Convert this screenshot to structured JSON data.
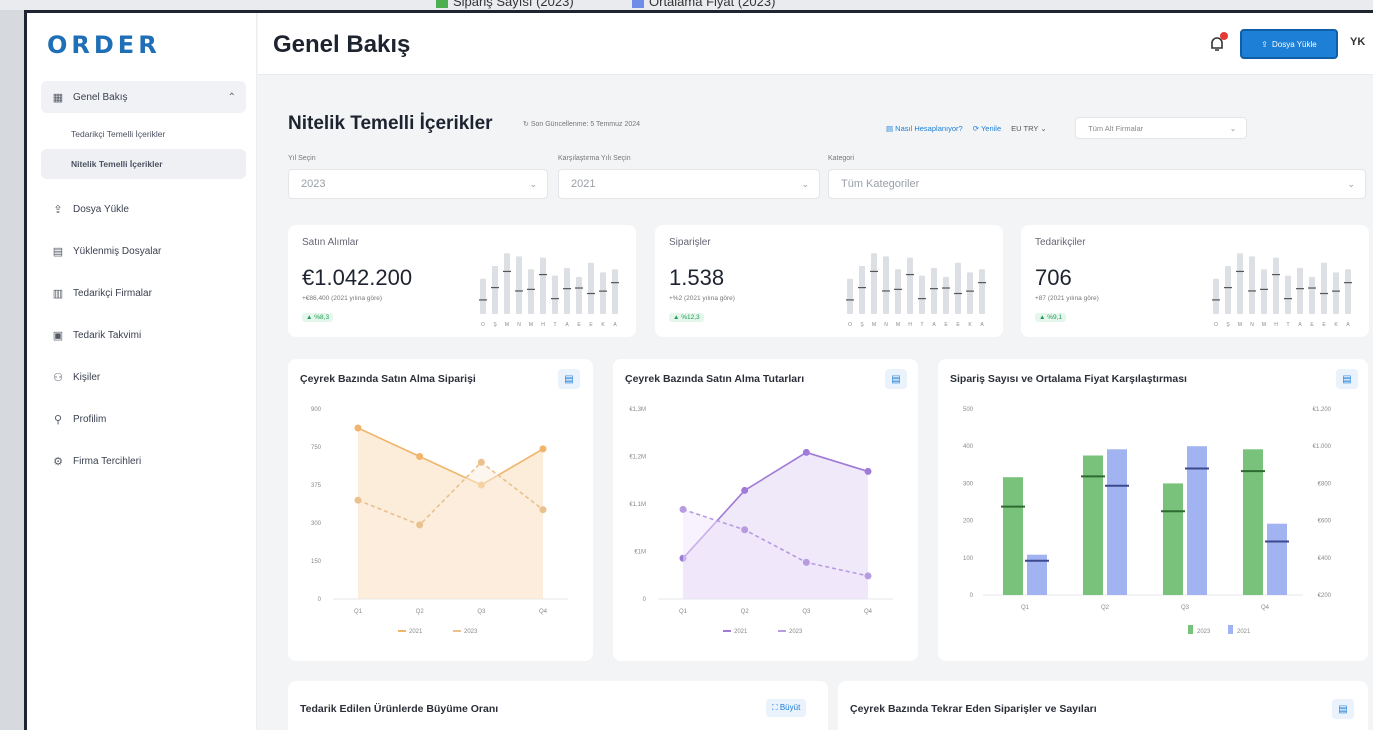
{
  "top_legend": [
    "Sipariş Sayısı (2023)",
    "Ortalama Fiyat (2023)"
  ],
  "brand": {
    "logo_text": "ORDER",
    "accent": "#1e7fd6"
  },
  "sidebar": {
    "items": [
      {
        "label": "Genel Bakış",
        "icon": "grid-icon"
      },
      {
        "label": "Dosya Yükle",
        "icon": "upload-icon"
      },
      {
        "label": "Yüklenmiş Dosyalar",
        "icon": "file-icon"
      },
      {
        "label": "Tedarikçi Firmalar",
        "icon": "building-icon"
      },
      {
        "label": "Tedarik Takvimi",
        "icon": "calendar-icon"
      },
      {
        "label": "Kişiler",
        "icon": "users-icon"
      },
      {
        "label": "Profilim",
        "icon": "user-icon"
      },
      {
        "label": "Firma Tercihleri",
        "icon": "settings-icon"
      }
    ],
    "subitems": [
      {
        "label": "Tedarikçi Temelli İçerikler"
      },
      {
        "label": "Nitelik Temelli İçerikler"
      }
    ]
  },
  "header": {
    "title": "Genel Bakış",
    "upload_label": "Dosya Yükle",
    "avatar": "YK"
  },
  "section": {
    "title": "Nitelik Temelli İçerikler",
    "subtitle": "Son Güncellenme: 5 Temmuz 2024",
    "help_link": "Nasıl Hesaplanıyor?",
    "refresh_label": "Yenile",
    "currency": "EU TRY",
    "company_placeholder": "Tüm Alt Firmalar"
  },
  "filters": {
    "year_label": "Yıl Seçin",
    "year_value": "2023",
    "compare_label": "Karşılaştırma Yılı Seçin",
    "compare_value": "2021",
    "category_label": "Kategori",
    "category_value": "Tüm Kategoriler"
  },
  "kpis": [
    {
      "title": "Satın Alımlar",
      "value": "€1.042.200",
      "note": "+€86,400 (2021 yılına göre)",
      "badge": "▲ %8,3"
    },
    {
      "title": "Siparişler",
      "value": "1.538",
      "note": "+%2 (2021 yılına göre)",
      "badge": "▲ %12,3"
    },
    {
      "title": "Tedarikçiler",
      "value": "706",
      "note": "+87 (2021 yılına göre)",
      "badge": "▲ %9,1"
    }
  ],
  "kpi_months": [
    "O",
    "Ş",
    "M",
    "N",
    "M",
    "H",
    "T",
    "A",
    "E",
    "E",
    "K",
    "A"
  ],
  "cards": {
    "c1": {
      "title": "Çeyrek Bazında Satın Alma Siparişi"
    },
    "c2": {
      "title": "Çeyrek Bazında Satın Alma Tutarları"
    },
    "c3": {
      "title": "Sipariş Sayısı ve Ortalama Fiyat Karşılaştırması"
    },
    "c4": {
      "title": "Tedarik Edilen Ürünlerde Büyüme Oranı",
      "expand": "Büyüt"
    },
    "c5": {
      "title": "Çeyrek Bazında Tekrar Eden Siparişler ve Sayıları"
    }
  },
  "chart_data": [
    {
      "type": "area",
      "categories": [
        "Q1",
        "Q2",
        "Q3",
        "Q4"
      ],
      "ylim": [
        0,
        1000
      ],
      "yticks": [
        "0",
        "150",
        "300",
        "375",
        "750",
        "900"
      ],
      "series": [
        {
          "name": "2021",
          "values": [
            900,
            750,
            600,
            790
          ]
        },
        {
          "name": "2023",
          "values": [
            520,
            390,
            720,
            470
          ]
        }
      ]
    },
    {
      "type": "area",
      "categories": [
        "Q1",
        "Q2",
        "Q3",
        "Q4"
      ],
      "ylim": [
        0,
        1.4
      ],
      "yticks": [
        "0",
        "€1M",
        "€1,1M",
        "€1,2M",
        "€1,3M"
      ],
      "series": [
        {
          "name": "2021",
          "values": [
            0.3,
            0.8,
            1.08,
            0.94
          ]
        },
        {
          "name": "2023",
          "values": [
            0.66,
            0.51,
            0.27,
            0.17
          ]
        }
      ]
    },
    {
      "type": "bar",
      "categories": [
        "Q1",
        "Q2",
        "Q3",
        "Q4"
      ],
      "ylim": [
        0,
        600
      ],
      "y2ticks": [
        "€200",
        "€400",
        "€600",
        "€800",
        "€1.000",
        "€1.200"
      ],
      "series": [
        {
          "name": "2023",
          "values": [
            380,
            450,
            360,
            470
          ],
          "color": "#78c27b"
        },
        {
          "name": "2021",
          "values": [
            130,
            470,
            480,
            230
          ],
          "color": "#a2b3f2"
        }
      ]
    }
  ]
}
